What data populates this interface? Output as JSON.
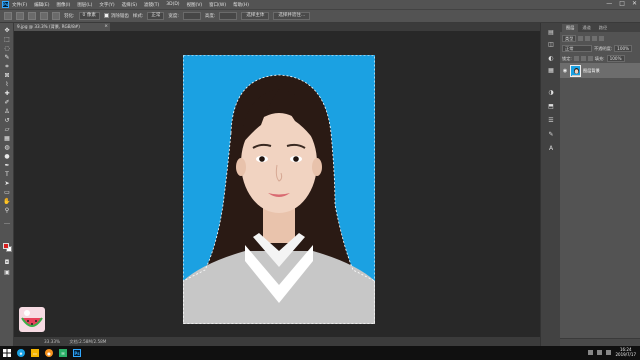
{
  "menubar": {
    "logo": "Ps",
    "items": [
      "文件(F)",
      "编辑(E)",
      "图像(I)",
      "图层(L)",
      "文字(Y)",
      "选择(S)",
      "滤镜(T)",
      "3D(D)",
      "视图(V)",
      "窗口(W)",
      "帮助(H)"
    ],
    "window_controls": [
      "—",
      "□",
      "✕"
    ]
  },
  "options": {
    "feather_label": "羽化:",
    "feather_value": "0 像素",
    "antialias_label": "消除锯齿",
    "style_label": "样式:",
    "style_value": "正常",
    "width_label": "宽度:",
    "height_label": "高度:",
    "refine_label": "选择并遮住...",
    "extra_label": "选择主体"
  },
  "document": {
    "tab_title": "9.jpg @ 33.3% (背景, RGB/8#)",
    "zoom": "33.33%",
    "doc_info": "文档:2.58M/2.58M"
  },
  "panels": {
    "tabs": [
      "图层",
      "通道",
      "路径"
    ],
    "kind_label": "类型",
    "blend_mode": "正常",
    "opacity_label": "不透明度:",
    "opacity_value": "100%",
    "lock_label": "锁定:",
    "fill_label": "填充:",
    "fill_value": "100%",
    "layer_name": "图层背景"
  },
  "taskbar": {
    "time": "16:24",
    "date": "2019/7/17"
  },
  "colors": {
    "photo_background": "#1ba1e2",
    "foreground_color": "#d61f1f",
    "background_color": "#ffffff"
  }
}
